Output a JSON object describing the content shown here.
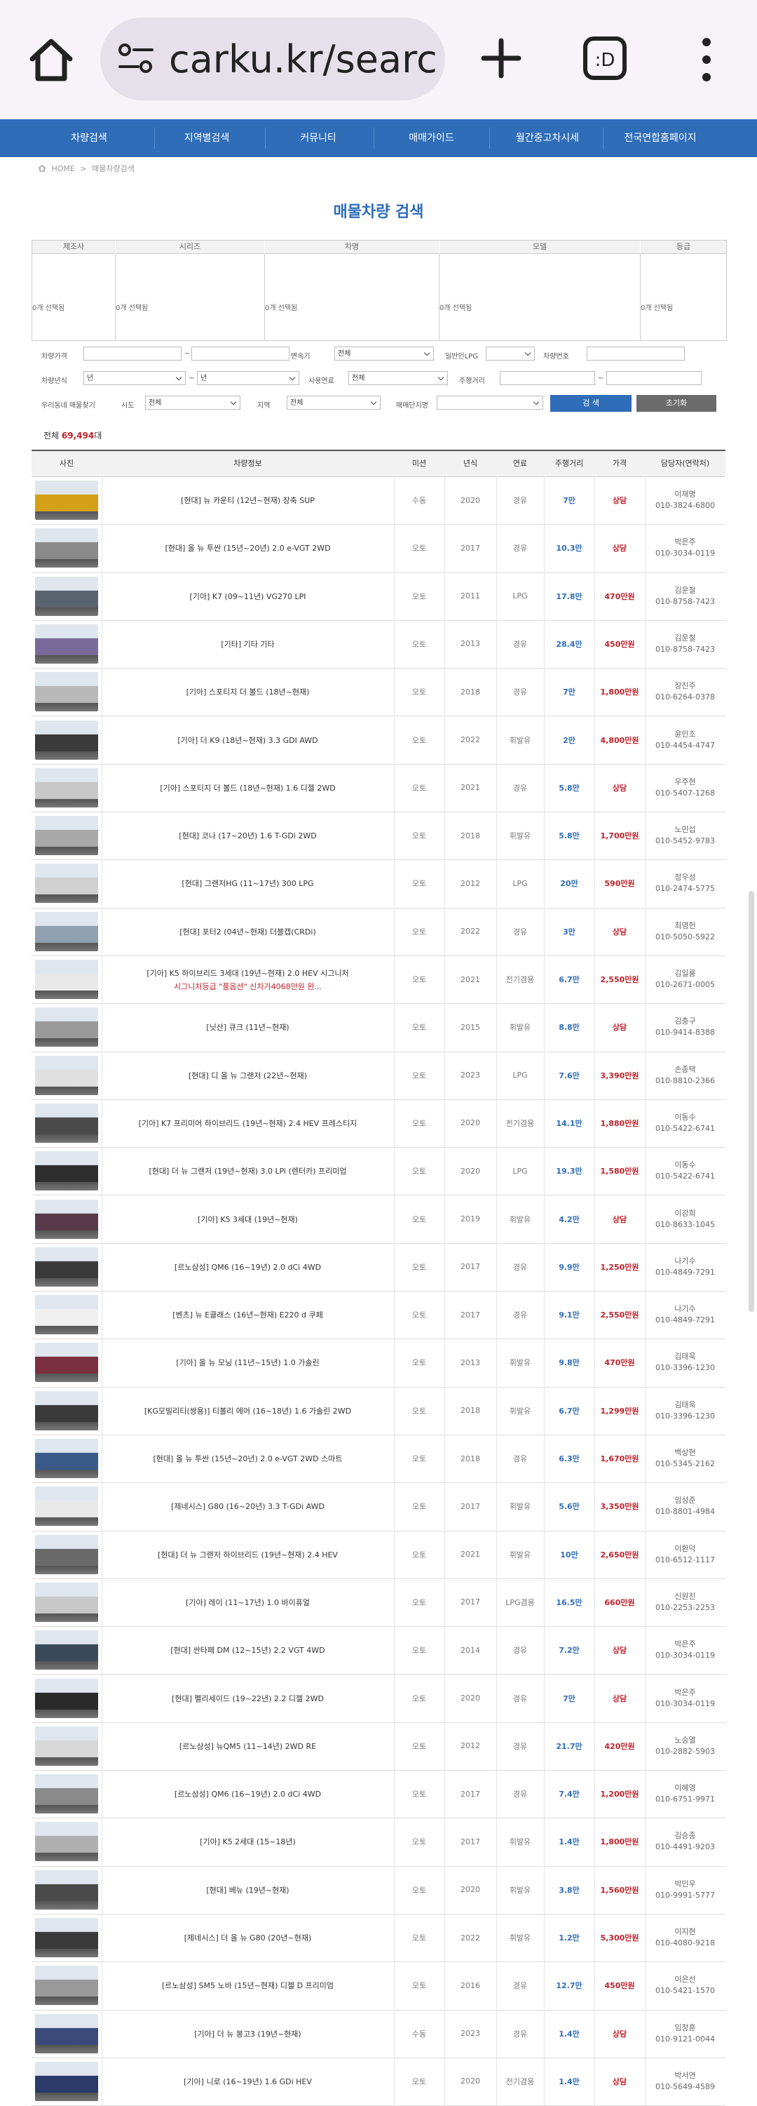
{
  "browser": {
    "url": "carku.kr/search"
  },
  "nav": {
    "items": [
      "차량검색",
      "지역별검색",
      "커뮤니티",
      "매매가이드",
      "월간중고차시세",
      "전국연합홈페이지"
    ]
  },
  "breadcrumb": {
    "home": "HOME",
    "sep": ">",
    "current": "매물차량검색"
  },
  "page_title": "매물차량 검색",
  "filter": {
    "headers": [
      "제조사",
      "시리즈",
      "차명",
      "모델",
      "등급"
    ],
    "values": [
      "0개 선택됨",
      "0개 선택됨",
      "0개 선택됨",
      "0개 선택됨",
      "0개 선택됨"
    ],
    "row1": {
      "price_label": "차량가격",
      "price_sep": "~",
      "trans_label": "변속기",
      "trans_value": "전체",
      "lpg_label": "일반인LPG",
      "carno_label": "차량번호"
    },
    "row2": {
      "year_label": "차량년식",
      "year_from": "년",
      "year_to": "년",
      "sep": "~",
      "fuel_label": "사용연료",
      "fuel_value": "전체",
      "mileage_label": "주행거리",
      "mileage_sep": "~"
    },
    "row3": {
      "region_label": "우리동네 매물찾기",
      "city_label": "시도",
      "city_value": "전체",
      "area_label": "지역",
      "area_value": "전체",
      "complex_label": "매매단지명"
    },
    "search_button": "검 색",
    "reset_button": "초기화"
  },
  "total": {
    "prefix": "전체",
    "count": "69,494",
    "suffix": "대"
  },
  "table": {
    "headers": [
      "사진",
      "차량정보",
      "미션",
      "년식",
      "연료",
      "주행거리",
      "가격",
      "담당자(연락처)"
    ],
    "rows": [
      {
        "name": "[현대] 뉴 카운티 (12년~현재) 장축 SUP",
        "sub": "",
        "mission": "수동",
        "year": "2020",
        "fuel": "경유",
        "km": "7만",
        "price": "상담",
        "person": "이재명",
        "phone": "010-3824-6800",
        "color": "#d4a017"
      },
      {
        "name": "[현대] 올 뉴 투싼 (15년~20년) 2.0 e-VGT 2WD",
        "sub": "",
        "mission": "오토",
        "year": "2017",
        "fuel": "경유",
        "km": "10.3만",
        "price": "상담",
        "person": "박은주",
        "phone": "010-3034-0119",
        "color": "#8a8a8a"
      },
      {
        "name": "[기아] K7 (09~11년) VG270 LPI",
        "sub": "",
        "mission": "오토",
        "year": "2011",
        "fuel": "LPG",
        "km": "17.8만",
        "price": "470만원",
        "person": "김운철",
        "phone": "010-8758-7423",
        "color": "#5a6470"
      },
      {
        "name": "[기타] 기타 기타",
        "sub": "",
        "mission": "오토",
        "year": "2013",
        "fuel": "경유",
        "km": "28.4만",
        "price": "450만원",
        "person": "김운철",
        "phone": "010-8758-7423",
        "color": "#7a6a9a"
      },
      {
        "name": "[기아] 스포티지 더 볼드 (18년~현재)",
        "sub": "",
        "mission": "오토",
        "year": "2018",
        "fuel": "경유",
        "km": "7만",
        "price": "1,800만원",
        "person": "장진주",
        "phone": "010-6264-0378",
        "color": "#b8b8b8"
      },
      {
        "name": "[기아] 더 K9 (18년~현재) 3.3 GDI AWD",
        "sub": "",
        "mission": "오토",
        "year": "2022",
        "fuel": "휘발유",
        "km": "2만",
        "price": "4,800만원",
        "person": "윤인조",
        "phone": "010-4454-4747",
        "color": "#3a3a3a"
      },
      {
        "name": "[기아] 스포티지 더 볼드 (18년~현재) 1.6 디젤 2WD",
        "sub": "",
        "mission": "오토",
        "year": "2021",
        "fuel": "경유",
        "km": "5.8만",
        "price": "상담",
        "person": "우주현",
        "phone": "010-5407-1268",
        "color": "#c8c8c8"
      },
      {
        "name": "[현대] 코나 (17~20년) 1.6 T-GDi 2WD",
        "sub": "",
        "mission": "오토",
        "year": "2018",
        "fuel": "휘발유",
        "km": "5.8만",
        "price": "1,700만원",
        "person": "노민섭",
        "phone": "010-5452-9783",
        "color": "#a9a9a9"
      },
      {
        "name": "[현대] 그랜저HG (11~17년) 300 LPG",
        "sub": "",
        "mission": "오토",
        "year": "2012",
        "fuel": "LPG",
        "km": "20만",
        "price": "590만원",
        "person": "정우성",
        "phone": "010-2474-5775",
        "color": "#d0d0d0"
      },
      {
        "name": "[현대] 포터2 (04년~현재) 더블캡(CRDi)",
        "sub": "",
        "mission": "오토",
        "year": "2022",
        "fuel": "경유",
        "km": "3만",
        "price": "상담",
        "person": "최영헌",
        "phone": "010-5050-5922",
        "color": "#8fa0b0"
      },
      {
        "name": "[기아] K5 하이브리드 3세대 (19년~현재) 2.0 HEV 시그니처",
        "sub": "시그니처등급 \"풀옵션\" 신차가4068만원 완...",
        "mission": "오토",
        "year": "2021",
        "fuel": "전기겸용",
        "km": "6.7만",
        "price": "2,550만원",
        "person": "김일룡",
        "phone": "010-2671-0005",
        "color": "#e8e8e8"
      },
      {
        "name": "[닛산] 큐크 (11년~현재)",
        "sub": "",
        "mission": "오토",
        "year": "2015",
        "fuel": "휘발유",
        "km": "8.8만",
        "price": "상담",
        "person": "김충구",
        "phone": "010-9414-8388",
        "color": "#9a9a9a"
      },
      {
        "name": "[현대] 디 올 뉴 그랜저 (22년~현재)",
        "sub": "",
        "mission": "오토",
        "year": "2023",
        "fuel": "LPG",
        "km": "7.6만",
        "price": "3,390만원",
        "person": "손종택",
        "phone": "010-8810-2366",
        "color": "#e0e0e0"
      },
      {
        "name": "[기아] K7 프리미어 하이브리드 (19년~현재) 2.4 HEV 프레스티지",
        "sub": "",
        "mission": "오토",
        "year": "2020",
        "fuel": "전기겸용",
        "km": "14.1만",
        "price": "1,880만원",
        "person": "이동수",
        "phone": "010-5422-6741",
        "color": "#4a4a4a"
      },
      {
        "name": "[현대] 더 뉴 그랜저 (19년~현재) 3.0 LPi (렌터카) 프리미엄",
        "sub": "",
        "mission": "오토",
        "year": "2020",
        "fuel": "LPG",
        "km": "19.3만",
        "price": "1,580만원",
        "person": "이동수",
        "phone": "010-5422-6741",
        "color": "#2e2e2e"
      },
      {
        "name": "[기아] K5 3세대 (19년~현재)",
        "sub": "",
        "mission": "오토",
        "year": "2019",
        "fuel": "휘발유",
        "km": "4.2만",
        "price": "상담",
        "person": "이강희",
        "phone": "010-8633-1045",
        "color": "#5a3a4a"
      },
      {
        "name": "[르노삼성] QM6 (16~19년) 2.0 dCi 4WD",
        "sub": "",
        "mission": "오토",
        "year": "2017",
        "fuel": "경유",
        "km": "9.9만",
        "price": "1,250만원",
        "person": "나기수",
        "phone": "010-4849-7291",
        "color": "#3a3a3a"
      },
      {
        "name": "[벤츠] 뉴 E클래스 (16년~현재) E220 d 쿠페",
        "sub": "",
        "mission": "오토",
        "year": "2017",
        "fuel": "경유",
        "km": "9.1만",
        "price": "2,550만원",
        "person": "나기수",
        "phone": "010-4849-7291",
        "color": "#f0f0f0"
      },
      {
        "name": "[기아] 올 뉴 모닝 (11년~15년) 1.0 가솔린",
        "sub": "",
        "mission": "오토",
        "year": "2013",
        "fuel": "휘발유",
        "km": "9.8만",
        "price": "470만원",
        "person": "김태욱",
        "phone": "010-3396-1230",
        "color": "#7a3040"
      },
      {
        "name": "[KG모빌리티(쌍용)] 티볼리 에어 (16~18년) 1.6 가솔린 2WD",
        "sub": "",
        "mission": "오토",
        "year": "2018",
        "fuel": "휘발유",
        "km": "6.7만",
        "price": "1,299만원",
        "person": "김태욱",
        "phone": "010-3396-1230",
        "color": "#3a3a3a"
      },
      {
        "name": "[현대] 올 뉴 투싼 (15년~20년) 2.0 e-VGT 2WD 스마트",
        "sub": "",
        "mission": "오토",
        "year": "2018",
        "fuel": "경유",
        "km": "6.3만",
        "price": "1,670만원",
        "person": "백상현",
        "phone": "010-5345-2162",
        "color": "#3a5a8a"
      },
      {
        "name": "[제네시스] G80 (16~20년) 3.3 T-GDi AWD",
        "sub": "",
        "mission": "오토",
        "year": "2017",
        "fuel": "휘발유",
        "km": "5.6만",
        "price": "3,350만원",
        "person": "임성준",
        "phone": "010-8801-4984",
        "color": "#e8e8e8"
      },
      {
        "name": "[현대] 더 뉴 그랜저 하이브리드 (19년~현재) 2.4 HEV",
        "sub": "",
        "mission": "오토",
        "year": "2021",
        "fuel": "휘발유",
        "km": "10만",
        "price": "2,650만원",
        "person": "이환덕",
        "phone": "010-6512-1117",
        "color": "#6a6a6a"
      },
      {
        "name": "[기아] 레이 (11~17년) 1.0 바이퓨얼",
        "sub": "",
        "mission": "오토",
        "year": "2017",
        "fuel": "LPG겸용",
        "km": "16.5만",
        "price": "660만원",
        "person": "신원진",
        "phone": "010-2253-2253",
        "color": "#c8c8c8"
      },
      {
        "name": "[현대] 싼타페 DM (12~15년) 2.2 VGT 4WD",
        "sub": "",
        "mission": "오토",
        "year": "2014",
        "fuel": "경유",
        "km": "7.2만",
        "price": "상담",
        "person": "박은주",
        "phone": "010-3034-0119",
        "color": "#3a4a5a"
      },
      {
        "name": "[현대] 펠리세이드 (19~22년) 2.2 디젤 2WD",
        "sub": "",
        "mission": "오토",
        "year": "2020",
        "fuel": "경유",
        "km": "7만",
        "price": "상담",
        "person": "박은주",
        "phone": "010-3034-0119",
        "color": "#2a2a2a"
      },
      {
        "name": "[르노삼성] 뉴QM5 (11~14년) 2WD RE",
        "sub": "",
        "mission": "오토",
        "year": "2012",
        "fuel": "경유",
        "km": "21.7만",
        "price": "420만원",
        "person": "노승열",
        "phone": "010-2882-5903",
        "color": "#d8d8d8"
      },
      {
        "name": "[르노삼성] QM6 (16~19년) 2.0 dCi 4WD",
        "sub": "",
        "mission": "오토",
        "year": "2017",
        "fuel": "경유",
        "km": "7.4만",
        "price": "1,200만원",
        "person": "이혜영",
        "phone": "010-6751-9971",
        "color": "#8a8a8a"
      },
      {
        "name": "[기아] K5 2세대 (15~18년)",
        "sub": "",
        "mission": "오토",
        "year": "2017",
        "fuel": "휘발유",
        "km": "1.4만",
        "price": "1,800만원",
        "person": "김승종",
        "phone": "010-4491-9203",
        "color": "#b0b0b0"
      },
      {
        "name": "[현대] 베뉴 (19년~현재)",
        "sub": "",
        "mission": "오토",
        "year": "2020",
        "fuel": "휘발유",
        "km": "3.8만",
        "price": "1,560만원",
        "person": "박민우",
        "phone": "010-9991-5777",
        "color": "#4a4a4a"
      },
      {
        "name": "[제네시스] 더 올 뉴 G80 (20년~현재)",
        "sub": "",
        "mission": "오토",
        "year": "2022",
        "fuel": "휘발유",
        "km": "1.2만",
        "price": "5,300만원",
        "person": "이지현",
        "phone": "010-4080-9218",
        "color": "#3a3a3a"
      },
      {
        "name": "[르노삼성] SM5 노바 (15년~현재) 디젤 D 프리미엄",
        "sub": "",
        "mission": "오토",
        "year": "2016",
        "fuel": "경유",
        "km": "12.7만",
        "price": "450만원",
        "person": "이은선",
        "phone": "010-5421-1570",
        "color": "#9a9a9a"
      },
      {
        "name": "[기아] 더 뉴 봉고3 (19년~현재)",
        "sub": "",
        "mission": "수동",
        "year": "2023",
        "fuel": "경유",
        "km": "1.4만",
        "price": "상담",
        "person": "임창훈",
        "phone": "010-9121-0044",
        "color": "#3a4a7a"
      },
      {
        "name": "[기아] 니로 (16~19년) 1.6 GDi HEV",
        "sub": "",
        "mission": "오토",
        "year": "2020",
        "fuel": "전기겸용",
        "km": "1.4만",
        "price": "상담",
        "person": "박서연",
        "phone": "010-5649-4589",
        "color": "#2a3a6a"
      }
    ]
  }
}
